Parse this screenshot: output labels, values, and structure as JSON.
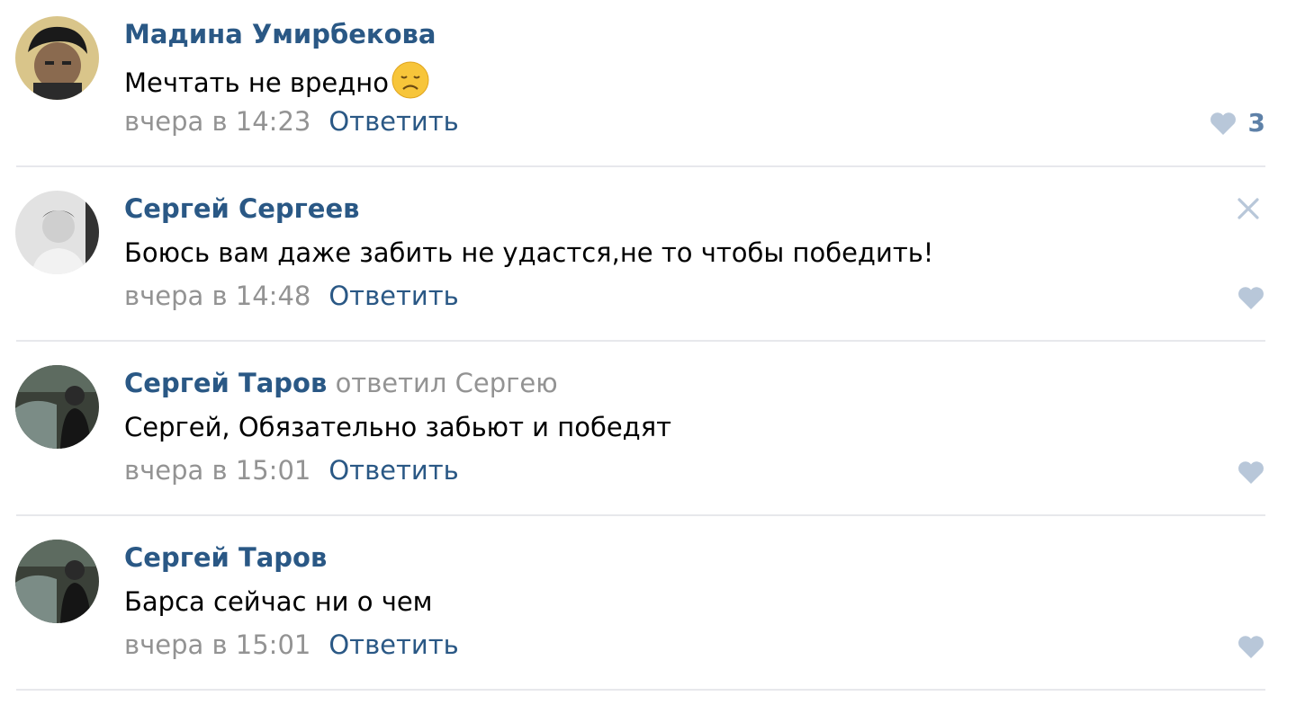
{
  "colors": {
    "author": "#2a5885",
    "muted": "#939393",
    "text": "#000000",
    "like_icon": "#b8c7d9",
    "like_count": "#5e81a8",
    "divider": "#e7e8ec"
  },
  "comments": [
    {
      "author": "Мадина Умирбекова",
      "reply_to": "",
      "text": "Мечтать не вредно",
      "emoji": "disappointed-face-emoji",
      "date": "вчера в 14:23",
      "reply_label": "Ответить",
      "likes": "3",
      "avatar_icon": "user-avatar-photo"
    },
    {
      "author": "Сергей Сергеев",
      "reply_to": "",
      "text": "Боюсь вам даже забить не удастся,не то чтобы победить!",
      "date": "вчера в 14:48",
      "reply_label": "Ответить",
      "likes": "",
      "avatar_icon": "user-avatar-photo",
      "close_icon": "close-icon"
    },
    {
      "author": "Сергей Таров",
      "reply_to": "ответил Сергею",
      "text": "Сергей, Обязательно забьют и победят",
      "date": "вчера в 15:01",
      "reply_label": "Ответить",
      "likes": "",
      "avatar_icon": "user-avatar-photo"
    },
    {
      "author": "Сергей Таров",
      "reply_to": "",
      "text": "Барса сейчас ни о чем",
      "date": "вчера в 15:01",
      "reply_label": "Ответить",
      "likes": "",
      "avatar_icon": "user-avatar-photo"
    }
  ]
}
